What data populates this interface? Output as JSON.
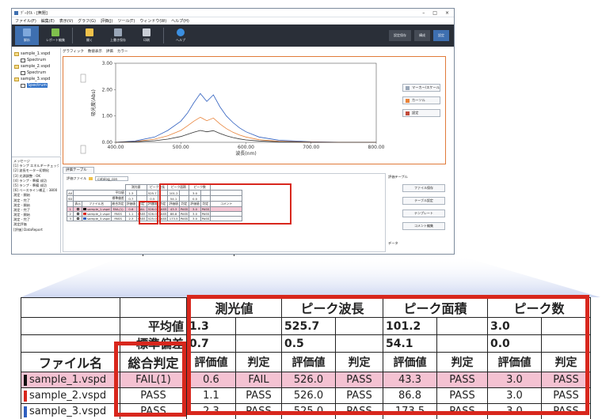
{
  "window": {
    "title": "ﾃﾞｰﾀｸﾙ - [無題]",
    "controls": [
      "–",
      "□",
      "×"
    ]
  },
  "menu": [
    "ファイル(F)",
    "編集(E)",
    "表示(V)",
    "グラフ(G)",
    "評価(J)",
    "ツール(T)",
    "ウィンドウ(W)",
    "ヘルプ(H)"
  ],
  "ribbon": {
    "buttons": [
      {
        "label": "解析",
        "icon": "analysis-icon",
        "color": "#3e6fb0"
      },
      {
        "label": "レポート編集",
        "icon": "report-icon",
        "color": "#7fbf4d"
      },
      {
        "label": "開く",
        "icon": "folder-icon",
        "color": "#f0c24a"
      },
      {
        "label": "上書き保存",
        "icon": "save-icon",
        "color": "#9aa7b8"
      },
      {
        "label": "印刷",
        "icon": "print-icon",
        "color": "#c9ced6"
      },
      {
        "label": "ヘルプ",
        "icon": "help-icon",
        "color": "#3b8fe0"
      }
    ],
    "right_buttons": [
      "設定保存",
      "構成",
      "設定"
    ]
  },
  "tree": {
    "items": [
      {
        "label": "sample_1.vspd",
        "level": 0
      },
      {
        "label": "Spectrum",
        "level": 1
      },
      {
        "label": "sample_2.vspd",
        "level": 0
      },
      {
        "label": "Spectrum",
        "level": 1
      },
      {
        "label": "sample_3.vspd",
        "level": 0
      },
      {
        "label": "Spectrum",
        "level": 1,
        "selected": true
      }
    ]
  },
  "messages": {
    "title": "メッセージ",
    "lines": [
      "[1] ランプ エネルギーチェック",
      "[2] 波長モーター初期化",
      "[3] 光源調整 : OK",
      "[4] ランプ - 準備 成功",
      "[5] ランプ - 準備 成功",
      "[6] ベースライン補正 : 3800",
      "測定 - 開始",
      "測定 - 完了",
      "測定 - 開始",
      "測定 - 完了",
      "測定 - 開始",
      "測定 - 完了",
      "測定評価",
      "[評価] DataReport"
    ]
  },
  "graph": {
    "tabs": [
      "グラフィック",
      "数値表示",
      "評価",
      "カラー"
    ],
    "side_buttons": [
      "マーカー/スケール",
      "カーソル",
      "設定"
    ],
    "colors": {
      "series1": "#2b4a8f",
      "series2": "#2f5fbf",
      "series3": "#e8833a",
      "frame": "#e07b3a"
    }
  },
  "chart_data": {
    "type": "line",
    "xlabel": "波長(nm)",
    "ylabel": "吸光度(Abs)",
    "xlim": [
      400,
      800
    ],
    "ylim": [
      0,
      3
    ],
    "x_ticks": [
      "400.00",
      "500.00",
      "600.00",
      "700.00",
      "800.00"
    ],
    "y_ticks": [
      "0.00",
      "1.00",
      "2.00",
      "3.00"
    ],
    "x": [
      400,
      430,
      460,
      480,
      500,
      510,
      520,
      530,
      540,
      550,
      560,
      570,
      580,
      590,
      600,
      620,
      650,
      700,
      750,
      800
    ],
    "series": [
      {
        "values": [
          0.0,
          0.05,
          0.2,
          0.45,
          0.8,
          1.1,
          1.5,
          1.85,
          1.55,
          1.8,
          1.35,
          1.0,
          0.75,
          0.55,
          0.4,
          0.2,
          0.08,
          0.02,
          0.0,
          0.0
        ]
      },
      {
        "values": [
          0.0,
          0.03,
          0.12,
          0.25,
          0.45,
          0.62,
          0.8,
          0.95,
          0.82,
          0.92,
          0.7,
          0.52,
          0.38,
          0.28,
          0.2,
          0.1,
          0.04,
          0.01,
          0.0,
          0.0
        ]
      },
      {
        "values": [
          0.0,
          0.02,
          0.06,
          0.12,
          0.22,
          0.3,
          0.38,
          0.45,
          0.4,
          0.44,
          0.34,
          0.25,
          0.18,
          0.13,
          0.09,
          0.05,
          0.02,
          0.0,
          0.0,
          0.0
        ]
      }
    ]
  },
  "eval": {
    "tab": "評価テーブル",
    "file_label": "評価ファイル",
    "file_value": "catalog_con",
    "comment_header": "コメント",
    "right_pane_title": "評価テーブル",
    "right_buttons": [
      "ファイル保存",
      "テーブル設定",
      "テンプレート",
      "コメント編集"
    ],
    "right_footer": "データ"
  },
  "table": {
    "groups": [
      "測光値",
      "ピーク波長",
      "ピーク面積",
      "ピーク数"
    ],
    "stat_labels": [
      "平均値",
      "標準偏差"
    ],
    "stats": {
      "mean": [
        "1.3",
        "525.7",
        "101.2",
        "3.0"
      ],
      "std": [
        "0.7",
        "0.5",
        "54.1",
        "0.0"
      ]
    },
    "headers": {
      "file": "ファイル名",
      "overall": "総合判定",
      "value": "評価値",
      "judge": "判定",
      "mini_display": "表示",
      "mini_file": "ファイル名"
    },
    "rows": [
      {
        "file": "sample_1.vspd",
        "color": "#111111",
        "overall": "FAIL(1)",
        "v1": "0.6",
        "j1": "FAIL",
        "v2": "526.0",
        "j2": "PASS",
        "v3": "43.3",
        "j3": "PASS",
        "v4": "3.0",
        "j4": "PASS"
      },
      {
        "file": "sample_2.vspd",
        "color": "#d8271d",
        "overall": "PASS",
        "v1": "1.1",
        "j1": "PASS",
        "v2": "526.0",
        "j2": "PASS",
        "v3": "86.8",
        "j3": "PASS",
        "v4": "3.0",
        "j4": "PASS"
      },
      {
        "file": "sample_3.vspd",
        "color": "#2f5fbf",
        "overall": "PASS",
        "v1": "2.3",
        "j1": "PASS",
        "v2": "525.0",
        "j2": "PASS",
        "v3": "173.5",
        "j3": "PASS",
        "v4": "3.0",
        "j4": "PASS"
      }
    ],
    "mini_row_labels": [
      "AX",
      "SD"
    ]
  },
  "highlight_color": "#d8271d"
}
